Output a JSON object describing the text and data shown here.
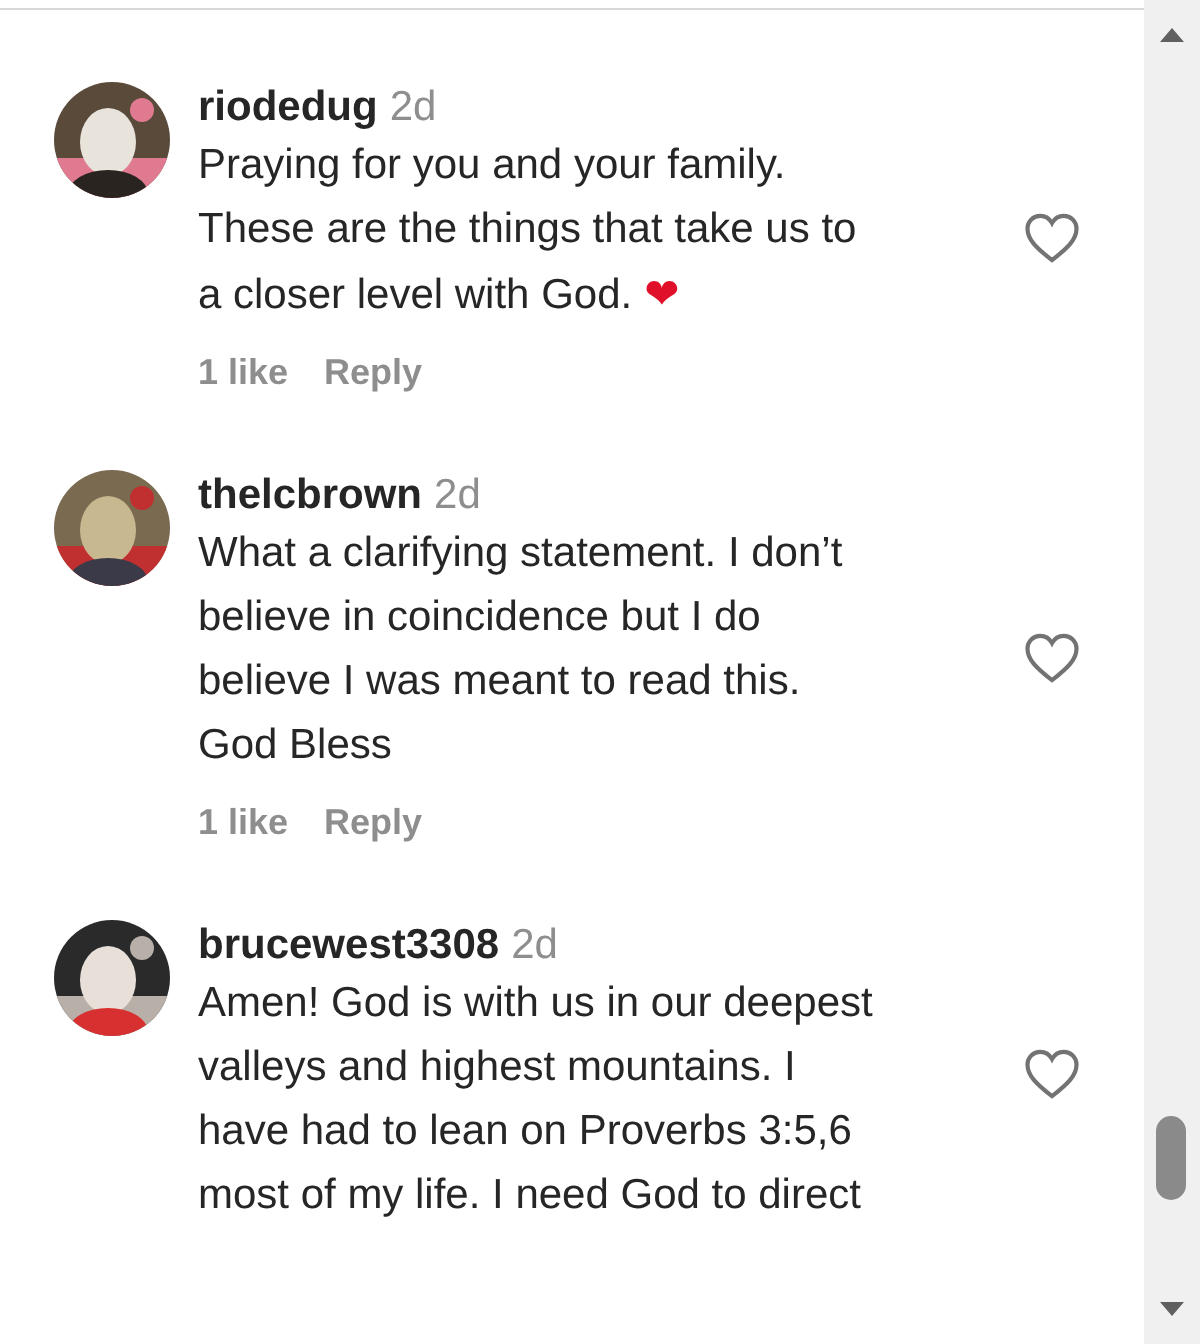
{
  "comments": [
    {
      "username": "riodedug",
      "time": "2d",
      "text": "Praying for you and your family.\nThese are the things that take us to\na closer level with God.",
      "emoji": "❤",
      "likes": "1 like",
      "reply": "Reply"
    },
    {
      "username": "thelcbrown",
      "time": "2d",
      "text": "What a clarifying statement. I don’t\nbelieve in coincidence but I do\nbelieve I was meant to read this.\nGod Bless",
      "likes": "1 like",
      "reply": "Reply"
    },
    {
      "username": "brucewest3308",
      "time": "2d",
      "text": "Amen! God is with us in our deepest\nvalleys and highest mountains. I\nhave had to lean on Proverbs 3:5,6\nmost of my life. I need God to direct"
    }
  ]
}
